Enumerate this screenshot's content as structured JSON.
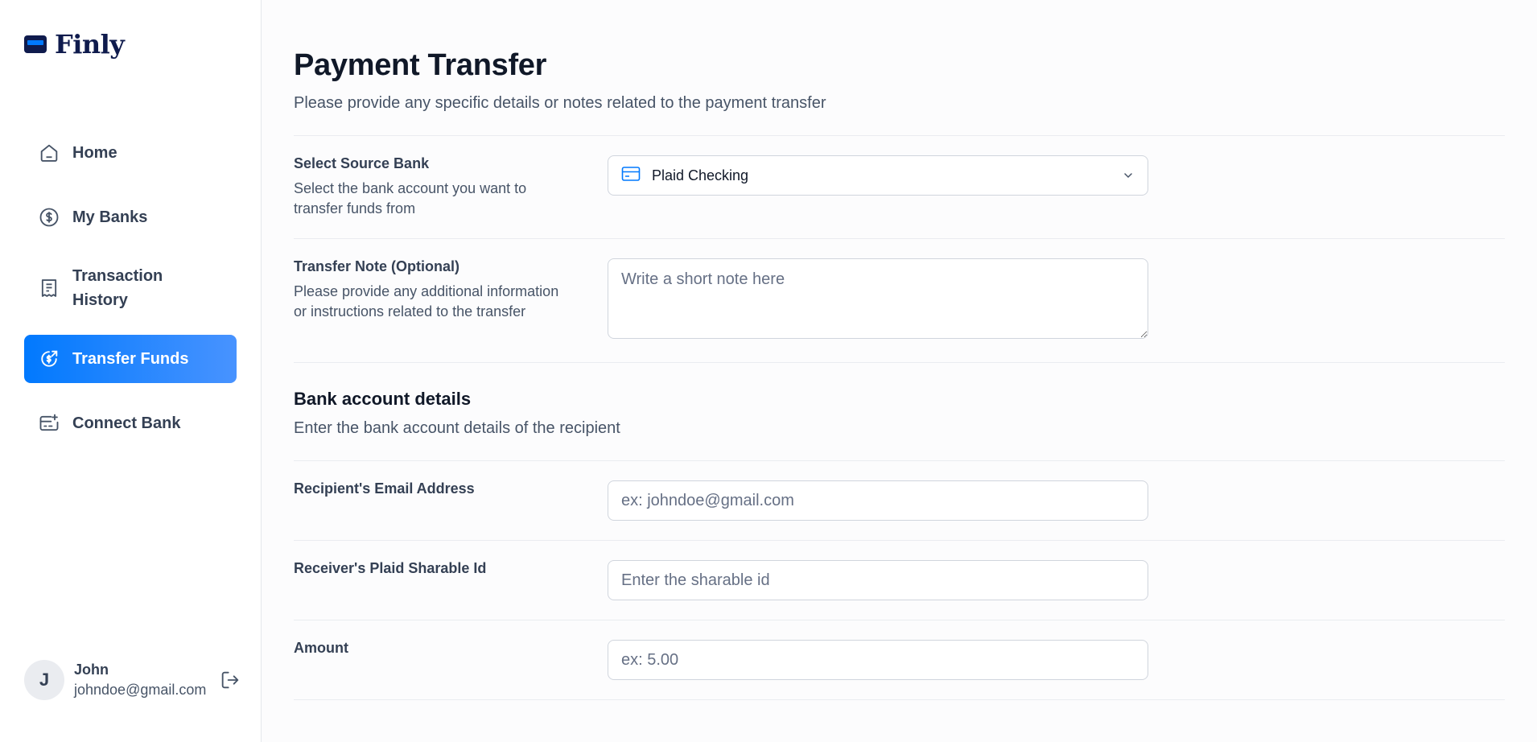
{
  "brand": {
    "name": "Finly",
    "logo_icon": "credit-card-icon"
  },
  "sidebar": {
    "items": [
      {
        "label": "Home",
        "icon": "home-icon",
        "active": false
      },
      {
        "label": "My Banks",
        "icon": "dollar-circle-icon",
        "active": false
      },
      {
        "label": "Transaction History",
        "icon": "receipt-icon",
        "active": false
      },
      {
        "label": "Transfer Funds",
        "icon": "money-send-icon",
        "active": true
      },
      {
        "label": "Connect Bank",
        "icon": "card-add-icon",
        "active": false
      }
    ],
    "user": {
      "initial": "J",
      "name": "John",
      "email": "johndoe@gmail.com"
    }
  },
  "page": {
    "title": "Payment Transfer",
    "subtitle": "Please provide any specific details or notes related to the payment transfer"
  },
  "form": {
    "source_bank": {
      "label": "Select Source Bank",
      "description": "Select the bank account you want to transfer funds from",
      "selected": "Plaid Checking"
    },
    "note": {
      "label": "Transfer Note (Optional)",
      "description": "Please provide any additional information or instructions related to the transfer",
      "placeholder": "Write a short note here"
    },
    "bank_section": {
      "title": "Bank account details",
      "subtitle": "Enter the bank account details of the recipient"
    },
    "email": {
      "label": "Recipient's Email Address",
      "placeholder": "ex: johndoe@gmail.com"
    },
    "sharable_id": {
      "label": "Receiver's Plaid Sharable Id",
      "placeholder": "Enter the sharable id"
    },
    "amount": {
      "label": "Amount",
      "placeholder": "ex: 5.00"
    }
  },
  "colors": {
    "accent": "#0179fe",
    "accent_light": "#4893ff",
    "brand_dark": "#0f1b4d",
    "text_primary": "#101828",
    "text_secondary": "#475467",
    "border": "#d0d5dd"
  }
}
